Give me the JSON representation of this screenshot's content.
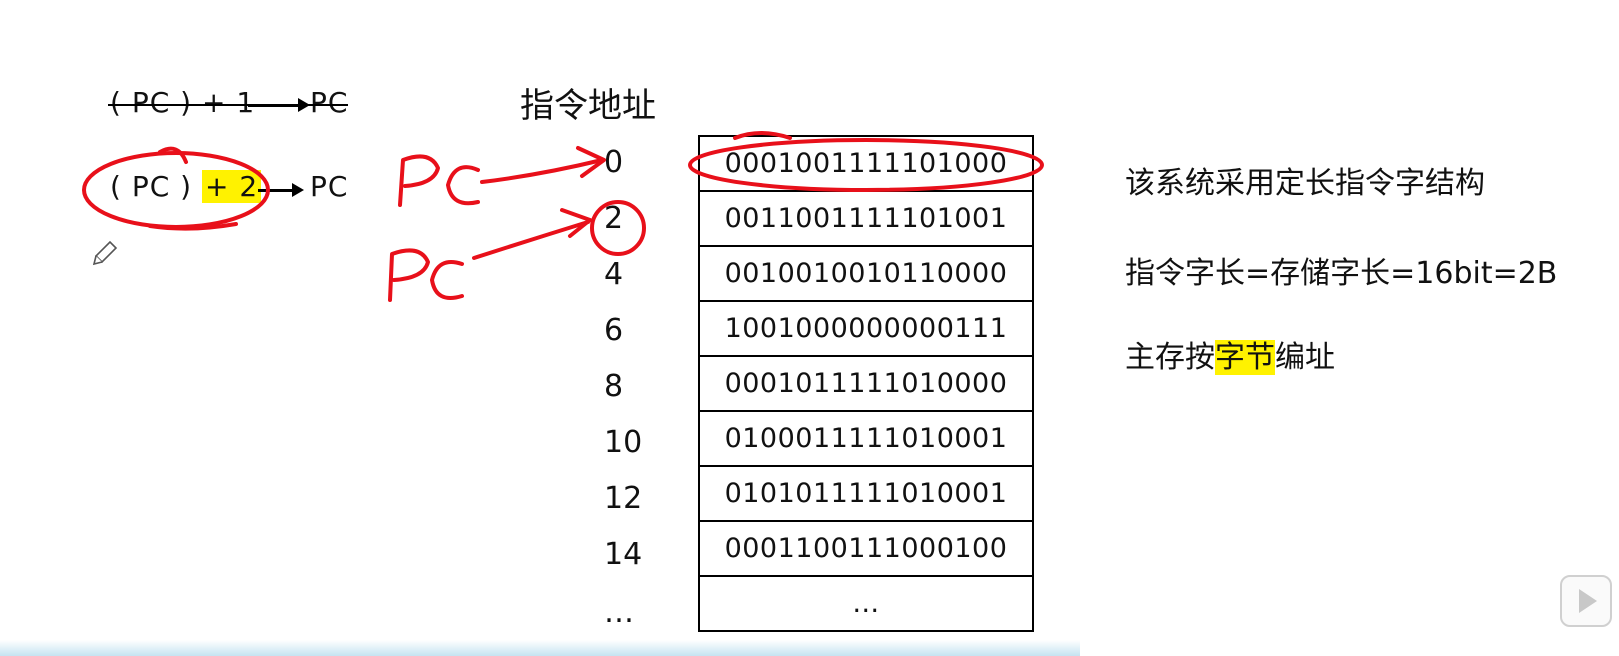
{
  "formulas": {
    "old": {
      "lhs": "( PC ) + 1",
      "rhs": "PC"
    },
    "new": {
      "lhs_pc": "( PC )",
      "lhs_inc": "+ 2",
      "rhs": "PC"
    }
  },
  "annotations": {
    "pc_label_1": "PC",
    "pc_label_2": "PC"
  },
  "memory": {
    "header": "指令地址",
    "addresses": [
      "0",
      "2",
      "4",
      "6",
      "8",
      "10",
      "12",
      "14",
      "…"
    ],
    "words": [
      "0001001111101000",
      "0011001111101001",
      "0010010010110000",
      "1001000000000111",
      "0001011111010000",
      "0100011111010001",
      "0101011111010001",
      "0001100111000100",
      "…"
    ]
  },
  "notes": {
    "line1": "该系统采用定长指令字结构",
    "line2": "指令字长=存储字长=16bit=2B",
    "line3_prefix": "主存按",
    "line3_highlight": "字节",
    "line3_suffix": "编址"
  },
  "colors": {
    "ink_red": "#e8101a",
    "highlight": "#fff200"
  }
}
